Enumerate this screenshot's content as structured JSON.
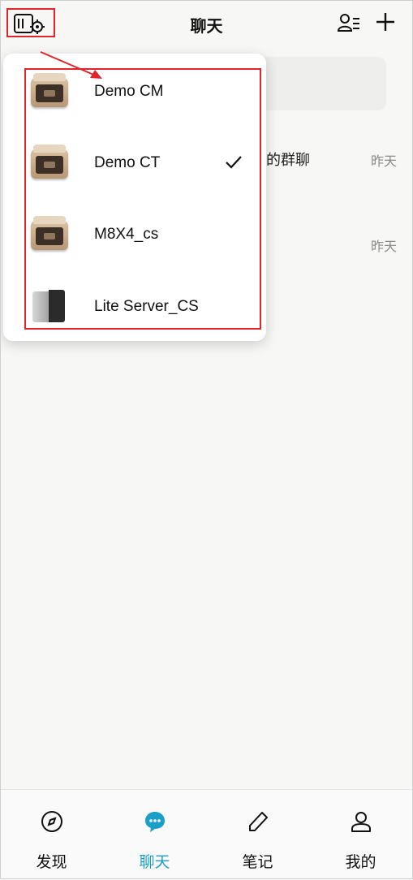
{
  "header": {
    "title": "聊天",
    "icons": {
      "server_switch": "server-settings-icon",
      "contacts": "contacts-list-icon",
      "add": "plus-icon"
    }
  },
  "chat_list": [
    {
      "name_fragment": "哥的群聊",
      "time": "昨天"
    },
    {
      "name_fragment": "",
      "time": "昨天"
    }
  ],
  "server_dropdown": {
    "items": [
      {
        "name": "Demo CM",
        "selected": false,
        "device": "nas"
      },
      {
        "name": "Demo CT",
        "selected": true,
        "device": "nas"
      },
      {
        "name": "M8X4_cs",
        "selected": false,
        "device": "nas"
      },
      {
        "name": "Lite Server_CS",
        "selected": false,
        "device": "tower"
      }
    ]
  },
  "bottom_nav": {
    "items": [
      {
        "label": "发现",
        "icon": "compass-icon",
        "active": false
      },
      {
        "label": "聊天",
        "icon": "chat-bubble-icon",
        "active": true
      },
      {
        "label": "笔记",
        "icon": "pen-icon",
        "active": false
      },
      {
        "label": "我的",
        "icon": "user-icon",
        "active": false
      }
    ]
  },
  "colors": {
    "accent": "#1a9fc9",
    "annotation_red": "#e0242a",
    "secondary_text": "#8a8a8a"
  }
}
